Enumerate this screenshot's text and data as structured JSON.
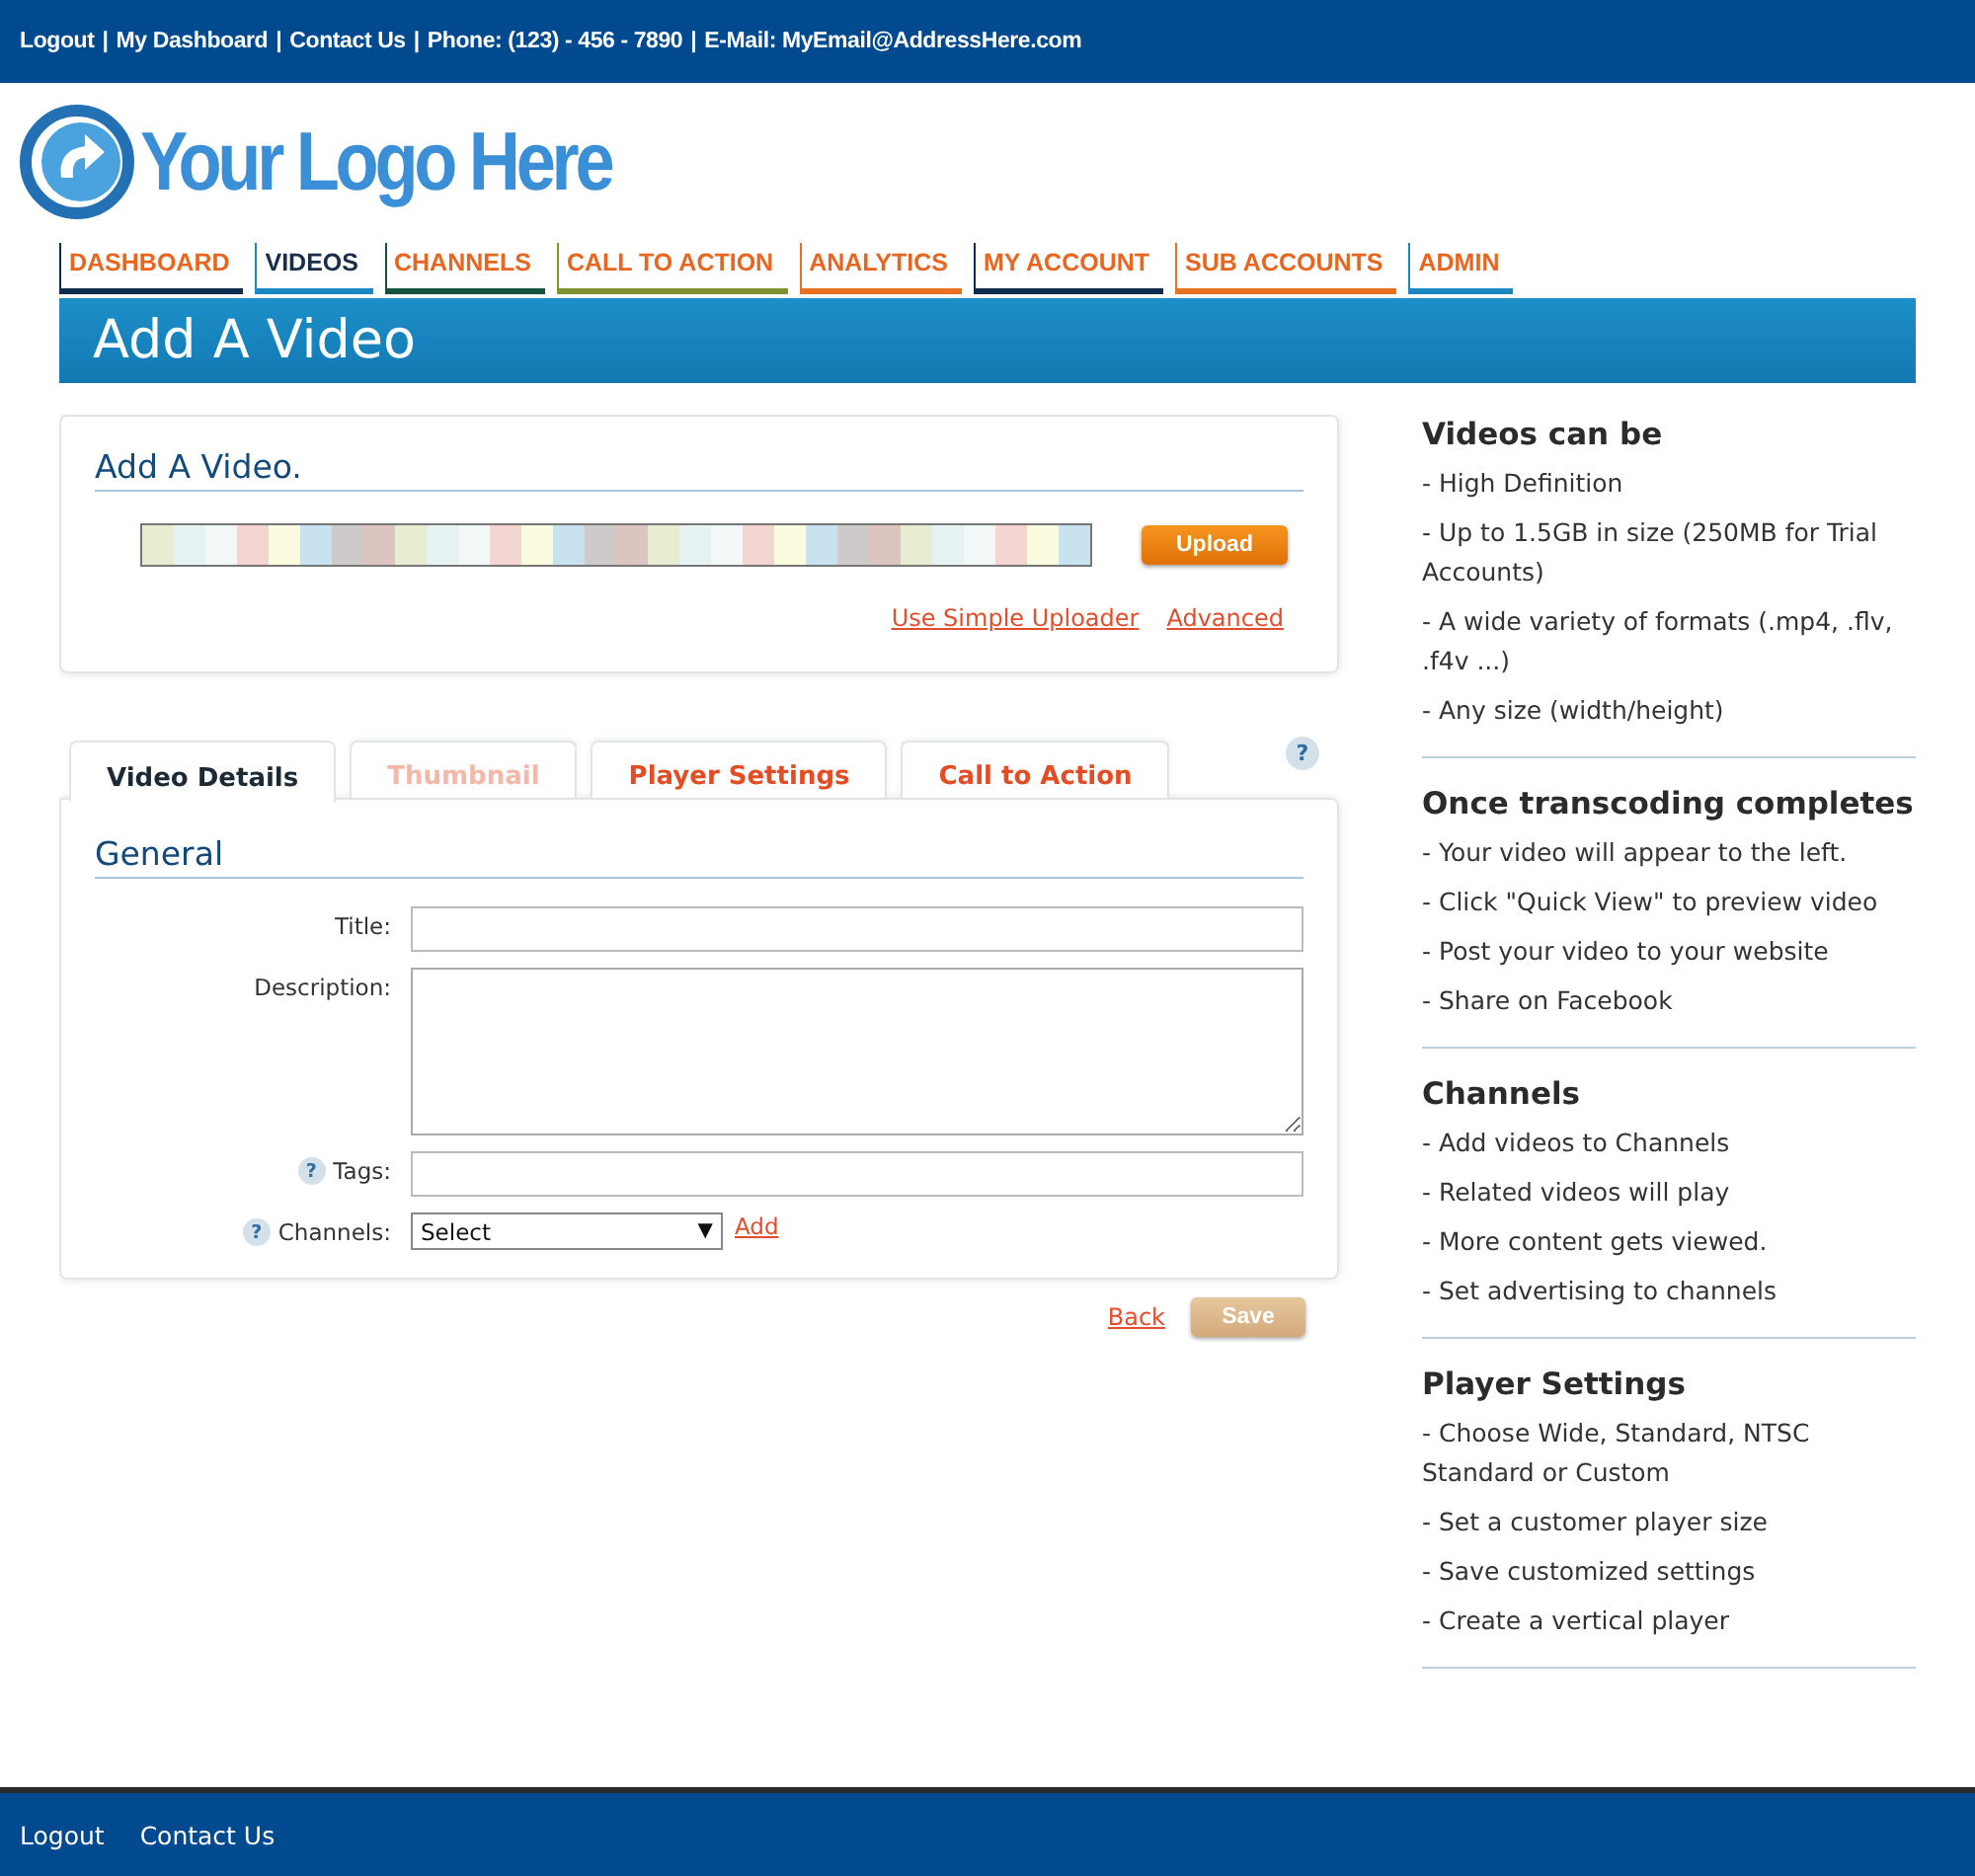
{
  "top_bar": {
    "separator": "|",
    "links": [
      "Logout",
      "My Dashboard",
      "Contact Us"
    ],
    "contact": [
      "Phone: (123) - 456 - 7890",
      "E-Mail: MyEmail@AddressHere.com"
    ]
  },
  "logo": {
    "text": "Your Logo Here"
  },
  "nav": [
    {
      "label": "DASHBOARD",
      "selected": false,
      "color": "#0d2b4e"
    },
    {
      "label": "VIDEOS",
      "selected": true,
      "color": "#1a87c0"
    },
    {
      "label": "CHANNELS",
      "selected": false,
      "color": "#14513f"
    },
    {
      "label": "CALL TO ACTION",
      "selected": false,
      "color": "#7f9331"
    },
    {
      "label": "ANALYTICS",
      "selected": false,
      "color": "#e8701f"
    },
    {
      "label": "MY ACCOUNT",
      "selected": false,
      "color": "#0d2b4e"
    },
    {
      "label": "SUB ACCOUNTS",
      "selected": false,
      "color": "#e8701f"
    },
    {
      "label": "ADMIN",
      "selected": false,
      "color": "#1a87c0"
    }
  ],
  "page_title": "Add A Video",
  "upload_panel": {
    "heading": "Add A Video.",
    "upload_button": "Upload",
    "links": [
      "Use Simple Uploader",
      "Advanced"
    ]
  },
  "form_tabs": [
    {
      "label": "Video Details",
      "selected": true,
      "disabled": false
    },
    {
      "label": "Thumbnail",
      "selected": false,
      "disabled": true
    },
    {
      "label": "Player Settings",
      "selected": false,
      "disabled": false
    },
    {
      "label": "Call to Action",
      "selected": false,
      "disabled": false
    }
  ],
  "help_icon": "?",
  "form": {
    "heading": "General",
    "fields": [
      {
        "kind": "text",
        "label": "Title:",
        "help": false
      },
      {
        "kind": "textarea",
        "label": "Description:",
        "help": false
      },
      {
        "kind": "text",
        "label": "Tags:",
        "help": true
      },
      {
        "kind": "select",
        "label": "Channels:",
        "help": true,
        "value": "Select",
        "caret": "▼",
        "link": "Add"
      }
    ]
  },
  "actions": {
    "back": "Back",
    "save": "Save"
  },
  "sidebar": [
    {
      "heading": "Videos can be",
      "items": [
        "-  High Definition",
        "-  Up to 1.5GB in size (250MB for Trial Accounts)",
        "-  A wide variety of formats (.mp4, .flv, .f4v ...)",
        "-  Any size (width/height)"
      ]
    },
    {
      "heading": "Once transcoding completes",
      "items": [
        "-  Your video will appear to the left.",
        "-  Click \"Quick View\" to preview video",
        "-  Post your video to your website",
        "-  Share on Facebook"
      ]
    },
    {
      "heading": "Channels",
      "items": [
        "-  Add videos to Channels",
        "-  Related videos will play",
        "-  More content gets viewed.",
        "-  Set advertising to channels"
      ]
    },
    {
      "heading": "Player Settings",
      "items": [
        "-  Choose Wide, Standard, NTSC Standard or Custom",
        "-  Set a customer player size",
        "-  Save customized settings",
        "-  Create a vertical player"
      ]
    }
  ],
  "footer": [
    "Logout",
    "Contact Us"
  ]
}
